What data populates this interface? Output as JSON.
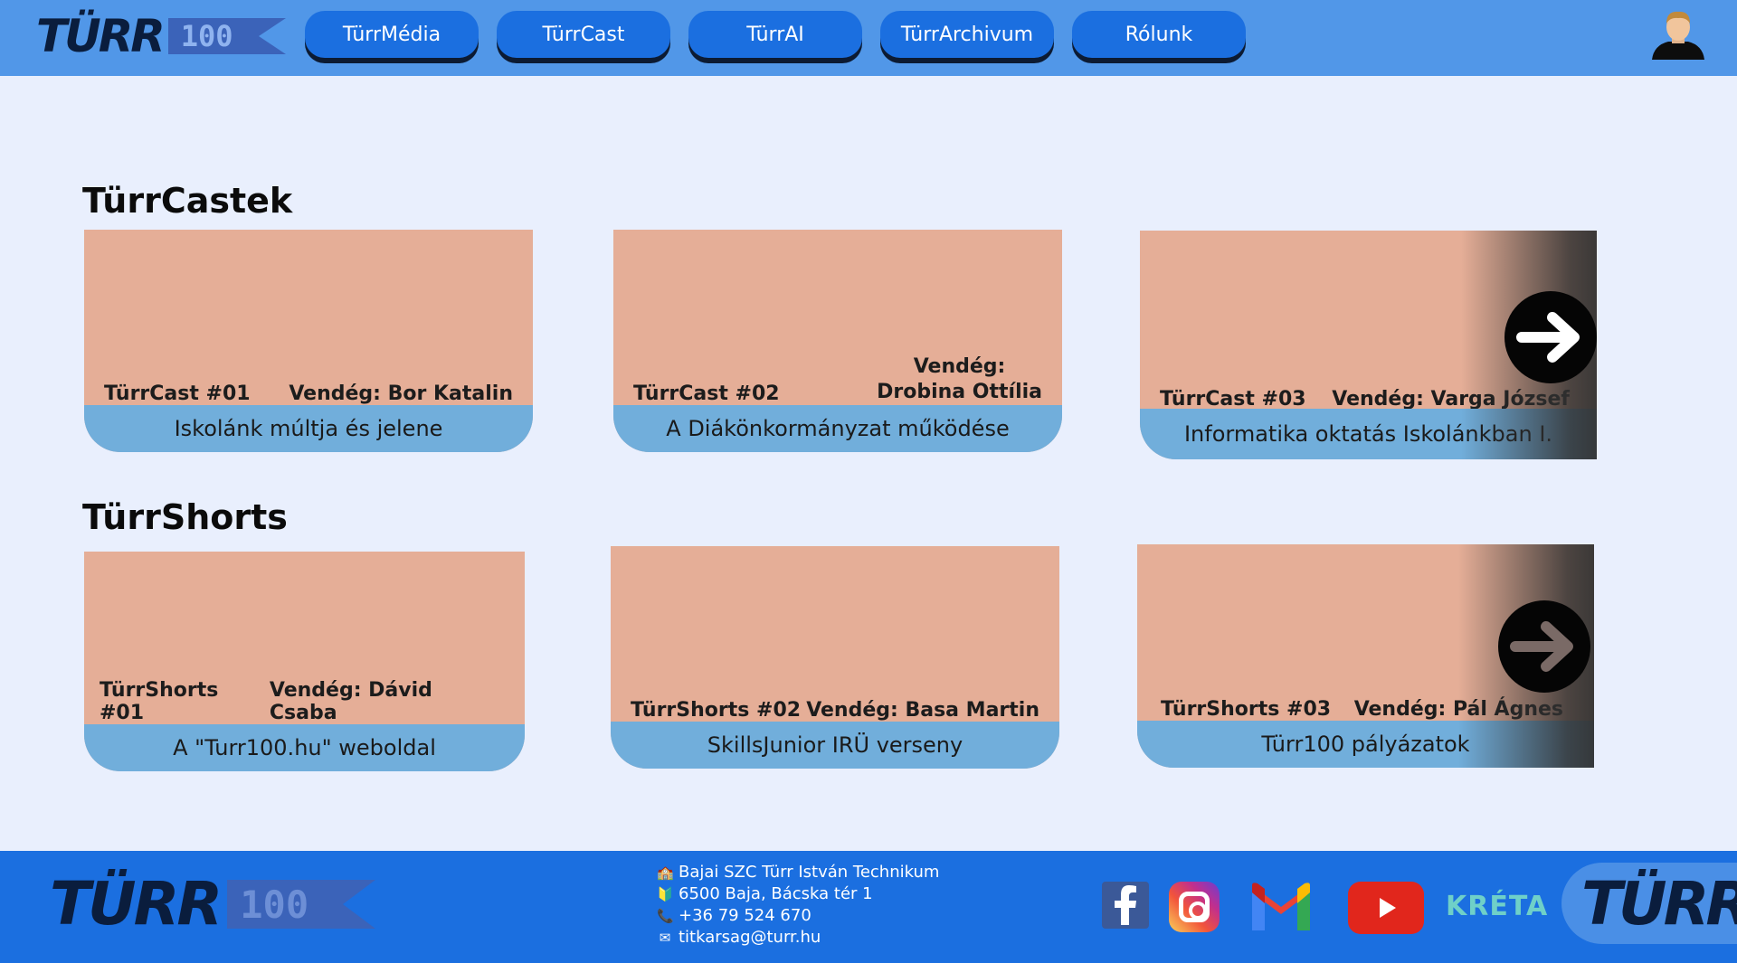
{
  "header": {
    "logo_main": "TÜRR",
    "logo_number": "100",
    "nav": [
      {
        "label": "TürrMédia"
      },
      {
        "label": "TürrCast"
      },
      {
        "label": "TürrAI"
      },
      {
        "label": "TürrArchivum"
      },
      {
        "label": "Rólunk"
      }
    ]
  },
  "sections": {
    "casts": {
      "title": "TürrCastek",
      "cards": [
        {
          "episode": "TürrCast #01",
          "guest": "Vendég: Bor Katalin",
          "topic": "Iskolánk múltja és jelene"
        },
        {
          "episode": "TürrCast #02",
          "guest_line1": "Vendég:",
          "guest_line2": "Drobina Ottília",
          "topic": "A Diákönkormányzat működése"
        },
        {
          "episode": "TürrCast #03",
          "guest": "Vendég: Varga József",
          "topic": "Informatika oktatás Iskolánkban I."
        }
      ]
    },
    "shorts": {
      "title": "TürrShorts",
      "cards": [
        {
          "episode": "TürrShorts #01",
          "guest": "Vendég: Dávid Csaba",
          "topic": "A \"Turr100.hu\" weboldal"
        },
        {
          "episode": "TürrShorts #02",
          "guest": "Vendég: Basa Martin",
          "topic": "SkillsJunior IRÜ verseny"
        },
        {
          "episode": "TürrShorts #03",
          "guest": "Vendég: Pál Ágnes",
          "topic": "Türr100 pályázatok"
        }
      ]
    }
  },
  "footer": {
    "logo_main": "TÜRR",
    "logo_number": "100",
    "contact": {
      "school": "Bajai SZC Türr István Technikum",
      "address": "6500 Baja, Bácska tér 1",
      "phone": "+36 79 524 670",
      "email": "titkarsag@turr.hu"
    },
    "social": {
      "kreta": "KRÉTA"
    },
    "badge": "TÜRR"
  },
  "colors": {
    "header_bg": "#5197e8",
    "nav_button": "#1b6fe0",
    "card_thumb": "#e5ae97",
    "card_caption": "#71aedb",
    "footer_bg": "#1b6fe0",
    "page_bg": "#e9effd"
  }
}
